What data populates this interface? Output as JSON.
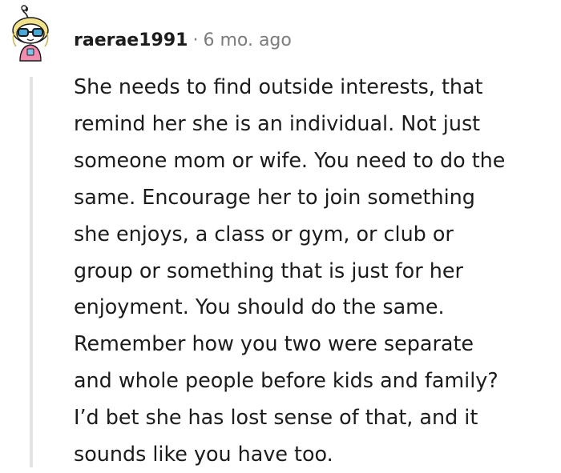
{
  "comment": {
    "username": "raerae1991",
    "separator": "·",
    "timestamp": "6 mo. ago",
    "lines": [
      "She needs to find outside interests, that",
      "remind her she is an individual. Not just",
      "someone mom or wife. You need to do the",
      "same. Encourage her to join something",
      "she enjoys, a class or gym, or club or",
      "group or something that is just for her",
      "enjoyment. You should do the same.",
      "Remember how you two were separate",
      "and whole people before kids and family?",
      "I’d bet she has lost sense of that, and it",
      "sounds like you have too."
    ]
  },
  "avatar": {
    "icon": "snoo-avatar-icon",
    "colors": {
      "hair": "#f3e28c",
      "glasses": "#1a1a1b",
      "lens": "#4aa8d8",
      "shirt": "#f28cb1",
      "skin": "#ffffff"
    }
  }
}
